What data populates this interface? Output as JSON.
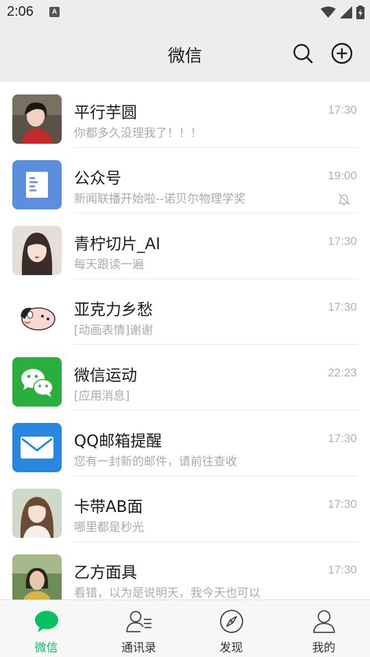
{
  "status_bar": {
    "time": "2:06",
    "notification_badge": "A",
    "icons": [
      "wifi-icon",
      "signal-icon",
      "battery-icon"
    ]
  },
  "header": {
    "title": "微信",
    "actions": [
      "search-icon",
      "add-circle-icon"
    ]
  },
  "chats": [
    {
      "name": "平行芋圆",
      "preview": "你都多久没理我了！！！",
      "time": "17:30",
      "avatar": "photo-avatar"
    },
    {
      "name": "公众号",
      "preview": "新闻联播开始啦--诺贝尔物理学奖",
      "time": "19:00",
      "avatar": "article-icon",
      "muted": true
    },
    {
      "name": "青柠切片_AI",
      "preview": "每天跟读一遍",
      "time": "17:30",
      "avatar": "photo-avatar"
    },
    {
      "name": "亚克力乡愁",
      "preview": "[动画表情]谢谢",
      "time": "17:30",
      "avatar": "cartoon-avatar"
    },
    {
      "name": "微信运动",
      "preview": "[应用消息]",
      "time": "22:23",
      "avatar": "wechat-logo-icon"
    },
    {
      "name": "QQ邮箱提醒",
      "preview": "您有一封新的邮件，请前往查收",
      "time": "17:30",
      "avatar": "mail-icon"
    },
    {
      "name": "卡带AB面",
      "preview": "哪里都是秒光",
      "time": "17:30",
      "avatar": "photo-avatar"
    },
    {
      "name": "乙方面具",
      "preview": "看错，以为是说明天，我今天也可以",
      "time": "17:30",
      "avatar": "photo-avatar"
    }
  ],
  "tabs": [
    {
      "label": "微信",
      "icon": "chat-bubble-icon",
      "active": true
    },
    {
      "label": "通讯录",
      "icon": "contacts-icon"
    },
    {
      "label": "发现",
      "icon": "compass-icon"
    },
    {
      "label": "我的",
      "icon": "person-icon"
    }
  ],
  "colors": {
    "accent": "#07c160",
    "background": "#ededed",
    "list_bg": "#ffffff"
  }
}
